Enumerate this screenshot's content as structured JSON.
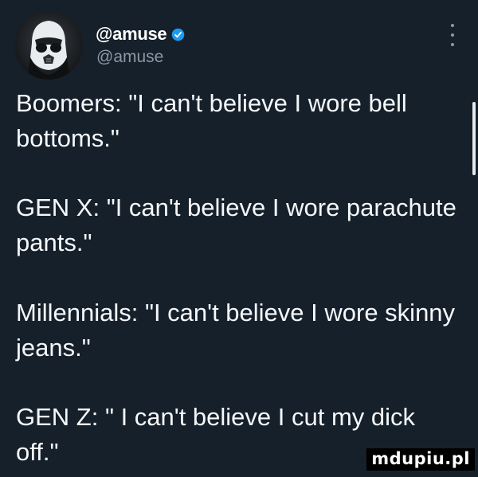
{
  "tweet": {
    "display_name": "@amuse",
    "handle": "@amuse",
    "lines": [
      "Boomers: \"I can't believe I wore bell bottoms.\"",
      "GEN X: \"I can't believe I wore parachute pants.\"",
      "Millennials: \"I can't believe I wore skinny jeans.\"",
      "GEN Z: \" I can't believe I cut my dick off.\""
    ]
  },
  "icons": {
    "avatar": "stormtrooper-avatar",
    "verified": "verified-badge-icon",
    "more": "more-options-icon"
  },
  "watermark": {
    "text": "mdupiu.pl"
  },
  "colors": {
    "background": "#16202b",
    "text": "#f5f8fa",
    "secondary_text": "#8b98a5",
    "verified_blue": "#1d9bf0"
  }
}
